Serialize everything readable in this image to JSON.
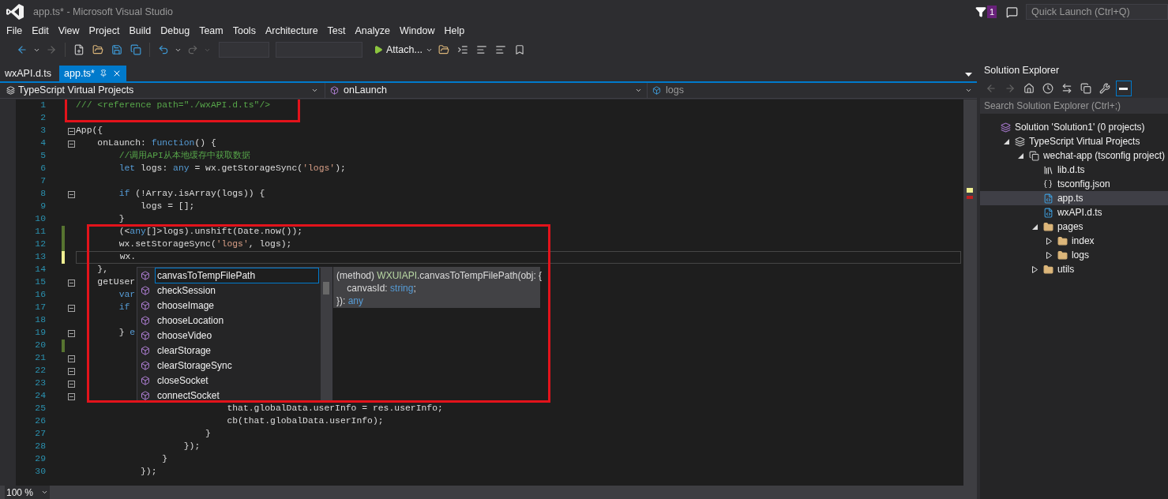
{
  "window": {
    "title": "app.ts* - Microsoft Visual Studio",
    "notification_count": "1",
    "quick_launch": {
      "placeholder": "Quick Launch (Ctrl+Q)"
    }
  },
  "menu": [
    "File",
    "Edit",
    "View",
    "Project",
    "Build",
    "Debug",
    "Team",
    "Tools",
    "Architecture",
    "Test",
    "Analyze",
    "Window",
    "Help"
  ],
  "toolbar": {
    "attach_button": "Attach..."
  },
  "tabs": [
    {
      "label": "wxAPI.d.ts",
      "selected": false
    },
    {
      "label": "app.ts*",
      "selected": true
    }
  ],
  "navigation_bar": {
    "project": "TypeScript Virtual Projects",
    "member": "onLaunch",
    "symbol": "logs"
  },
  "editor": {
    "zoom": "100 %",
    "lines": [
      {
        "number": "1",
        "tokens": [
          {
            "kind": "comment",
            "text": "/// <reference path=\"./wxAPI.d.ts\"/>"
          }
        ]
      },
      {
        "number": "2"
      },
      {
        "number": "3",
        "fold": true,
        "tokens": [
          {
            "kind": "plain",
            "text": "App({"
          }
        ]
      },
      {
        "number": "4",
        "fold": true,
        "tokens": [
          {
            "kind": "plain",
            "text": "    onLaunch: "
          },
          {
            "kind": "keyword",
            "text": "function"
          },
          {
            "kind": "plain",
            "text": "() {"
          }
        ]
      },
      {
        "number": "5",
        "tokens": [
          {
            "kind": "comment",
            "text": "        //调用API从本地缓存中获取数据"
          }
        ]
      },
      {
        "number": "6",
        "tokens": [
          {
            "kind": "keyword",
            "text": "        let"
          },
          {
            "kind": "plain",
            "text": " logs: "
          },
          {
            "kind": "keyword",
            "text": "any"
          },
          {
            "kind": "plain",
            "text": " = wx.getStorageSync("
          },
          {
            "kind": "string",
            "text": "'logs'"
          },
          {
            "kind": "plain",
            "text": ");"
          }
        ]
      },
      {
        "number": "7"
      },
      {
        "number": "8",
        "fold": true,
        "tokens": [
          {
            "kind": "keyword",
            "text": "        if"
          },
          {
            "kind": "plain",
            "text": " (!Array.isArray(logs)) {"
          }
        ]
      },
      {
        "number": "9",
        "tokens": [
          {
            "kind": "plain",
            "text": "            logs = [];"
          }
        ]
      },
      {
        "number": "10",
        "tokens": [
          {
            "kind": "plain",
            "text": "        }"
          }
        ]
      },
      {
        "number": "11",
        "changed": true,
        "saved": true,
        "tokens": [
          {
            "kind": "plain",
            "text": "        (<"
          },
          {
            "kind": "keyword",
            "text": "any"
          },
          {
            "kind": "plain",
            "text": "[]>logs).unshift(Date.now());"
          }
        ]
      },
      {
        "number": "12",
        "changed": true,
        "saved": true,
        "tokens": [
          {
            "kind": "plain",
            "text": "        wx.setStorageSync("
          },
          {
            "kind": "string",
            "text": "'logs'"
          },
          {
            "kind": "plain",
            "text": ", logs);"
          }
        ]
      },
      {
        "number": "13",
        "changed": true,
        "saved": false,
        "current": true,
        "tokens": [
          {
            "kind": "plain",
            "text": "        wx."
          }
        ]
      },
      {
        "number": "14",
        "tokens": [
          {
            "kind": "plain",
            "text": "    },"
          }
        ]
      },
      {
        "number": "15",
        "fold": true,
        "tokens": [
          {
            "kind": "plain",
            "text": "    getUser"
          }
        ]
      },
      {
        "number": "16",
        "tokens": [
          {
            "kind": "keyword",
            "text": "        var"
          }
        ]
      },
      {
        "number": "17",
        "fold": true,
        "tokens": [
          {
            "kind": "keyword",
            "text": "        if"
          }
        ]
      },
      {
        "number": "18"
      },
      {
        "number": "19",
        "fold": true,
        "tokens": [
          {
            "kind": "plain",
            "text": "        } "
          },
          {
            "kind": "keyword",
            "text": "e"
          }
        ]
      },
      {
        "number": "20",
        "changed": true,
        "saved": true
      },
      {
        "number": "21",
        "fold": true
      },
      {
        "number": "22",
        "fold": true
      },
      {
        "number": "23",
        "fold": true
      },
      {
        "number": "24",
        "fold": true
      },
      {
        "number": "25",
        "tokens": [
          {
            "kind": "plain",
            "text": "                            that.globalData.userInfo = res.userInfo;"
          }
        ]
      },
      {
        "number": "26",
        "tokens": [
          {
            "kind": "plain",
            "text": "                            cb(that.globalData.userInfo);"
          }
        ]
      },
      {
        "number": "27",
        "tokens": [
          {
            "kind": "plain",
            "text": "                        }"
          }
        ]
      },
      {
        "number": "28",
        "tokens": [
          {
            "kind": "plain",
            "text": "                    });"
          }
        ]
      },
      {
        "number": "29",
        "tokens": [
          {
            "kind": "plain",
            "text": "                }"
          }
        ]
      },
      {
        "number": "30",
        "tokens": [
          {
            "kind": "plain",
            "text": "            });"
          }
        ]
      }
    ]
  },
  "completion": {
    "items": [
      {
        "label": "canvasToTempFilePath",
        "selected": true
      },
      {
        "label": "checkSession",
        "selected": false
      },
      {
        "label": "chooseImage",
        "selected": false
      },
      {
        "label": "chooseLocation",
        "selected": false
      },
      {
        "label": "chooseVideo",
        "selected": false
      },
      {
        "label": "clearStorage",
        "selected": false
      },
      {
        "label": "clearStorageSync",
        "selected": false
      },
      {
        "label": "closeSocket",
        "selected": false
      },
      {
        "label": "connectSocket",
        "selected": false
      }
    ],
    "tooltip": [
      [
        {
          "kind": "plain",
          "text": "(method) "
        },
        {
          "kind": "type",
          "text": "WXUIAPI"
        },
        {
          "kind": "plain",
          "text": ".canvasToTempFilePath(obj: {"
        }
      ],
      [
        {
          "kind": "plain",
          "text": "    canvasId: "
        },
        {
          "kind": "keyword",
          "text": "string"
        },
        {
          "kind": "plain",
          "text": ";"
        }
      ],
      [
        {
          "kind": "plain",
          "text": "}): "
        },
        {
          "kind": "keyword",
          "text": "any"
        }
      ]
    ]
  },
  "solution_explorer": {
    "title": "Solution Explorer",
    "search": {
      "placeholder": "Search Solution Explorer (Ctrl+;)"
    },
    "tree": [
      {
        "label": "Solution 'Solution1' (0 projects)",
        "kind": "solution",
        "selected": false,
        "children": [
          {
            "label": "TypeScript Virtual Projects",
            "kind": "virtual",
            "selected": false,
            "expanded": true,
            "children": [
              {
                "label": "wechat-app (tsconfig project)",
                "kind": "project",
                "selected": false,
                "expanded": true,
                "children": [
                  {
                    "label": "lib.d.ts",
                    "kind": "library",
                    "selected": false
                  },
                  {
                    "label": "tsconfig.json",
                    "kind": "json",
                    "selected": false
                  },
                  {
                    "label": "app.ts",
                    "kind": "script",
                    "selected": true
                  },
                  {
                    "label": "wxAPI.d.ts",
                    "kind": "script",
                    "selected": false
                  },
                  {
                    "label": "pages",
                    "kind": "folder",
                    "selected": false,
                    "expanded": true,
                    "children": [
                      {
                        "label": "index",
                        "kind": "folder",
                        "selected": false,
                        "expanded": false
                      },
                      {
                        "label": "logs",
                        "kind": "folder",
                        "selected": false,
                        "expanded": false
                      }
                    ]
                  },
                  {
                    "label": "utils",
                    "kind": "folder",
                    "selected": false,
                    "expanded": false
                  }
                ]
              }
            ]
          }
        ]
      }
    ]
  }
}
